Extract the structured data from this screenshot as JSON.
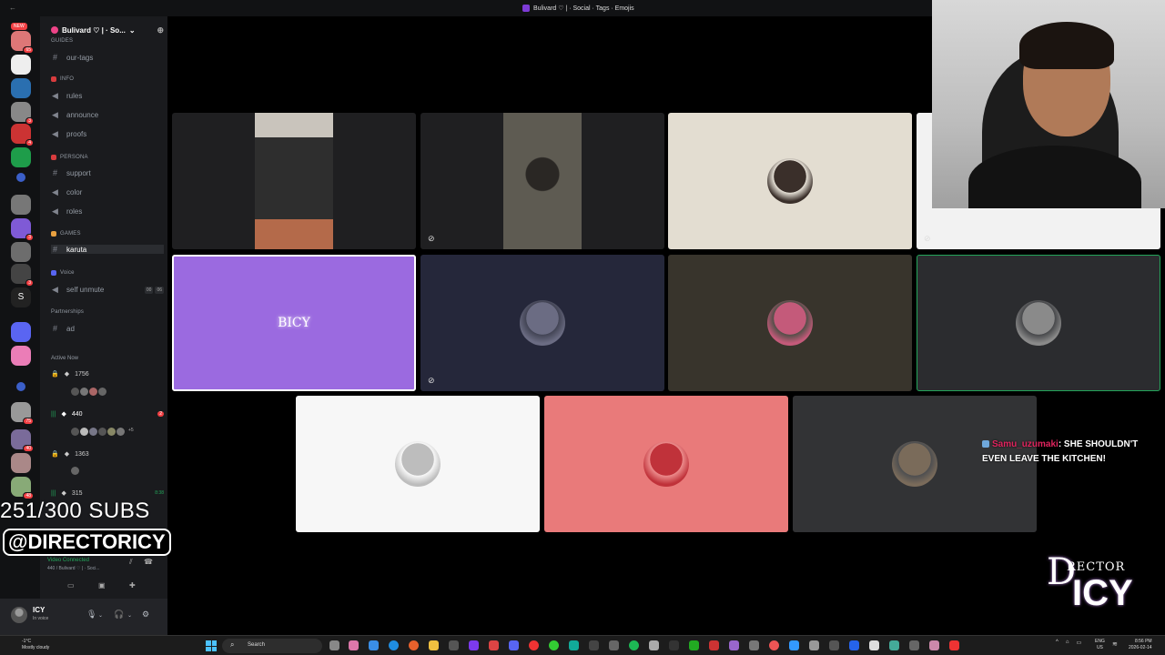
{
  "window": {
    "title": "Bulivard ♡ | · Social · Tags · Emojis",
    "back_icon": "arrow-left-icon"
  },
  "server": {
    "name": "Bulivard ♡ | · So..."
  },
  "rail": {
    "new_label": "NEW",
    "badges": [
      "65",
      "3",
      "4",
      "3",
      "3",
      "75",
      "40",
      "48"
    ],
    "letter_server": "S"
  },
  "sidebar": {
    "top_cut": "GUIDES",
    "channels_top": [
      {
        "name": "our-tags",
        "icon": "hash-icon"
      }
    ],
    "categories": [
      {
        "name": "INFO",
        "channels": [
          {
            "name": "rules",
            "icon": "announce-icon"
          },
          {
            "name": "announce",
            "icon": "announce-icon"
          },
          {
            "name": "proofs",
            "icon": "announce-icon"
          }
        ]
      },
      {
        "name": "PERSONA",
        "channels": [
          {
            "name": "support",
            "icon": "hash-icon"
          },
          {
            "name": "color",
            "icon": "announce-icon"
          },
          {
            "name": "roles",
            "icon": "announce-icon"
          }
        ]
      },
      {
        "name": "GAMES",
        "channels": [
          {
            "name": "karuta",
            "icon": "hash-icon"
          }
        ]
      },
      {
        "name": "Voice",
        "channels": [
          {
            "name": "self unmute",
            "icon": "speaker-icon",
            "count_a": "00",
            "count_b": "06"
          }
        ]
      },
      {
        "name": "Partnerships",
        "channels": [
          {
            "name": "ad",
            "icon": "hash-icon"
          }
        ]
      }
    ],
    "active_now_label": "Active Now",
    "active_channels": [
      {
        "name": "1756",
        "locked": true
      },
      {
        "name": "440",
        "locked": false,
        "ping": "2",
        "extra": "+5"
      },
      {
        "name": "1363",
        "locked": true
      },
      {
        "name": "315",
        "time": "8:38"
      }
    ]
  },
  "voice_panel": {
    "status": "Video Connected",
    "channel": "440 / Bulivard ♡ | · Soci..."
  },
  "user": {
    "name": "ICY",
    "status": "In voice"
  },
  "overlay": {
    "subs": "251/300 SUBS",
    "handle": "@DIRECTORICY"
  },
  "tiles": [
    {
      "kind": "camera",
      "bg": "#1f1f21",
      "feed": "#2a2a2a",
      "muted": false
    },
    {
      "kind": "camera",
      "bg": "#1f1f21",
      "feed": "#4a4a44",
      "muted": true
    },
    {
      "kind": "avatar",
      "bg": "#e3ddd1",
      "avatar": "#3a2f2a",
      "muted": false
    },
    {
      "kind": "partial",
      "bg": "#f2f2f2",
      "muted": true
    },
    {
      "kind": "text",
      "bg": "#9b6ae0",
      "label": "BICY",
      "muted": false
    },
    {
      "kind": "avatar",
      "bg": "#25273a",
      "avatar": "#6b6c83",
      "muted": true
    },
    {
      "kind": "avatar",
      "bg": "#38342c",
      "avatar": "#c45a7a",
      "muted": false
    },
    {
      "kind": "avatar",
      "bg": "#2b2c2f",
      "avatar": "#8a8a8a",
      "muted": false
    },
    {
      "kind": "avatar",
      "bg": "#f7f7f7",
      "avatar": "#bdbdbd",
      "muted": false
    },
    {
      "kind": "avatar",
      "bg": "#e97a7a",
      "avatar": "#c0323a",
      "muted": false
    },
    {
      "kind": "avatar",
      "bg": "#323335",
      "avatar": "#7a6b5a",
      "muted": false
    }
  ],
  "chat": {
    "username": "Samu_uzumaki",
    "message": ": SHE SHOULDN'T EVEN LEAVE THE KITCHEN!"
  },
  "brand": {
    "line1": "D",
    "line2": "RECTOR",
    "line3": "ICY"
  },
  "taskbar": {
    "weather_temp": "-1°C",
    "weather_desc": "Mostly cloudy",
    "search_placeholder": "Search",
    "lang_top": "ENG",
    "lang_bottom": "US",
    "time": "8:56 PM",
    "date": "2026-02-14"
  },
  "colors": {
    "accent": "#5865f2",
    "speaking_ring": "#23a55a",
    "danger": "#f23f43"
  }
}
